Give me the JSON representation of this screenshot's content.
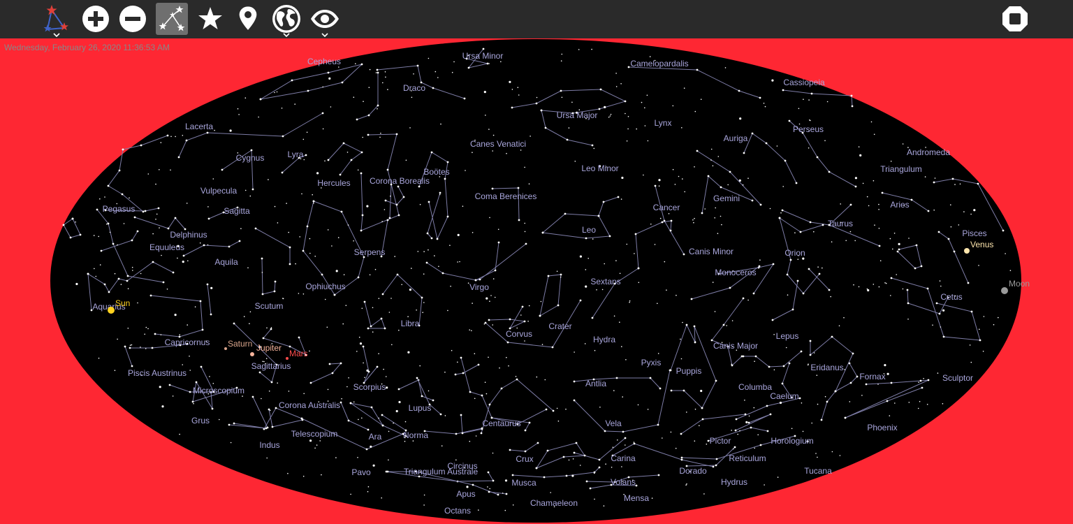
{
  "datetime": "Wednesday, February 26, 2020 11:36:53 AM",
  "colors": {
    "background": "#fe2733",
    "toolbar": "#2a2a2a",
    "sky": "#000000",
    "constellation_label": "#a9a6dc",
    "constellation_line": "#7d7ca6",
    "sun": "#ffd21f",
    "venus": "#fde5ad",
    "saturn": "#d9a58c",
    "jupiter": "#f7b49c",
    "mars": "#ff4c4c",
    "moon": "#9a9a9a"
  },
  "toolbar": {
    "buttons": [
      {
        "name": "constellations-menu-button",
        "icon": "constellation-star-icon",
        "has_dropdown": true,
        "active": false
      },
      {
        "name": "zoom-in-button",
        "icon": "plus-circle-icon",
        "has_dropdown": false,
        "active": false
      },
      {
        "name": "zoom-out-button",
        "icon": "minus-circle-icon",
        "has_dropdown": false,
        "active": false
      },
      {
        "name": "constellation-lines-toggle",
        "icon": "constellation-lines-icon",
        "has_dropdown": false,
        "active": true
      },
      {
        "name": "stars-toggle",
        "icon": "star-icon",
        "has_dropdown": false,
        "active": false
      },
      {
        "name": "location-button",
        "icon": "map-pin-icon",
        "has_dropdown": false,
        "active": false
      },
      {
        "name": "globe-button",
        "icon": "globe-icon",
        "has_dropdown": true,
        "active": false
      },
      {
        "name": "view-options-button",
        "icon": "eye-icon",
        "has_dropdown": true,
        "active": false
      }
    ],
    "stop_button": {
      "name": "stop-button",
      "icon": "stop-octagon-icon"
    }
  },
  "constellations": [
    "Cepheus",
    "Ursa Minor",
    "Camelopardalis",
    "Draco",
    "Cassiopeia",
    "Lacerta",
    "Ursa Major",
    "Lynx",
    "Auriga",
    "Perseus",
    "Cygnus",
    "Lyra",
    "Canes Venatici",
    "Andromeda",
    "Triangulum",
    "Hercules",
    "Corona Borealis",
    "Boötes",
    "Leo Minor",
    "Vulpecula",
    "Pegasus",
    "Sagitta",
    "Coma Berenices",
    "Cancer",
    "Gemini",
    "Aries",
    "Taurus",
    "Delphinus",
    "Leo",
    "Pisces",
    "Equuleus",
    "Serpens",
    "Canis Minor",
    "Orion",
    "Aquila",
    "Monoceros",
    "Ophiuchus",
    "Virgo",
    "Sextans",
    "Aquarius",
    "Scutum",
    "Cetus",
    "Libra",
    "Corvus",
    "Crater",
    "Hydra",
    "Canis Major",
    "Lepus",
    "Capricornus",
    "Sagittarius",
    "Pyxis",
    "Puppis",
    "Eridanus",
    "Fornax",
    "Sculptor",
    "Piscis Austrinus",
    "Scorpius",
    "Antlia",
    "Columba",
    "Caelum",
    "Microscopium",
    "Corona Australis",
    "Lupus",
    "Centaurus",
    "Vela",
    "Grus",
    "Phoenix",
    "Telescopium",
    "Ara",
    "Norma",
    "Pictor",
    "Horologium",
    "Indus",
    "Circinus",
    "Crux",
    "Carina",
    "Reticulum",
    "Pavo",
    "Triangulum Australe",
    "Dorado",
    "Tucana",
    "Musca",
    "Volans",
    "Hydrus",
    "Apus",
    "Mensa",
    "Chamaeleon",
    "Octans"
  ],
  "planets": [
    {
      "name": "Sun"
    },
    {
      "name": "Venus"
    },
    {
      "name": "Moon"
    },
    {
      "name": "Saturn"
    },
    {
      "name": "Jupiter"
    },
    {
      "name": "Mars"
    }
  ]
}
